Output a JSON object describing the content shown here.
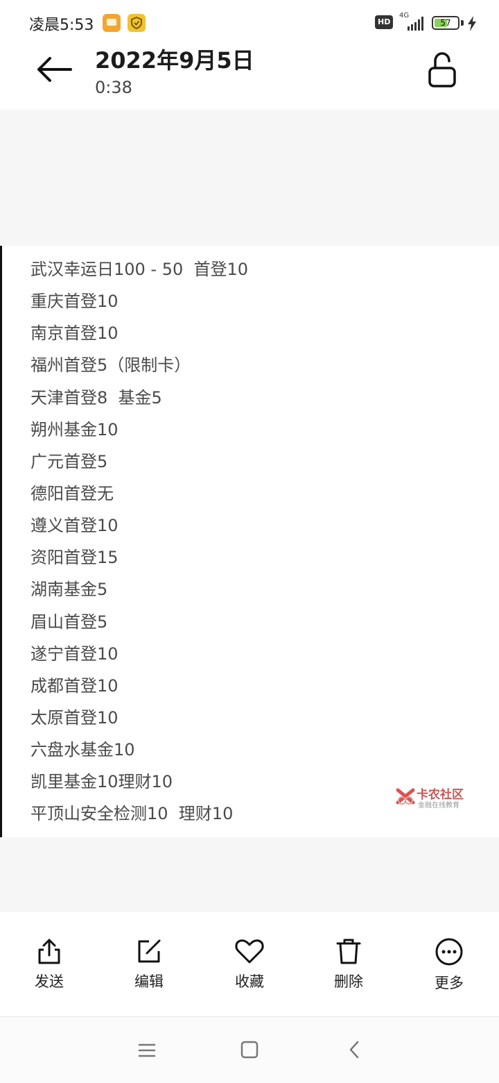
{
  "status_bar": {
    "time": "凌晨5:53",
    "hd": "HD",
    "network": "4G",
    "battery": "57",
    "battery_level": 0.57,
    "icons": [
      "files-notification-icon",
      "shield-notification-icon",
      "signal-icon",
      "battery-icon",
      "charging-icon"
    ]
  },
  "header": {
    "title": "2022年9月5日",
    "subtitle": "0:38",
    "back_icon": "arrow-left-icon",
    "lock_icon": "unlock-icon"
  },
  "note": {
    "lines": [
      "武汉幸运日100 - 50  首登10",
      "重庆首登10",
      "南京首登10",
      "福州首登5（限制卡）",
      "天津首登8  基金5",
      "朔州基金10",
      "广元首登5",
      "德阳首登无",
      "遵义首登10",
      "资阳首登15",
      "湖南基金5",
      "眉山首登5",
      "遂宁首登10",
      "成都首登10",
      "太原首登10",
      "六盘水基金10",
      "凯里基金10理财10",
      "平顶山安全检测10  理财10"
    ],
    "watermark": {
      "title": "卡农社区",
      "subtitle": "金融在线教育"
    }
  },
  "actions": [
    {
      "label": "发送",
      "icon": "share-icon"
    },
    {
      "label": "编辑",
      "icon": "edit-icon"
    },
    {
      "label": "收藏",
      "icon": "heart-icon"
    },
    {
      "label": "删除",
      "icon": "trash-icon"
    },
    {
      "label": "更多",
      "icon": "more-icon"
    }
  ],
  "nav": {
    "icons": [
      "menu-icon",
      "home-icon",
      "back-icon"
    ]
  }
}
